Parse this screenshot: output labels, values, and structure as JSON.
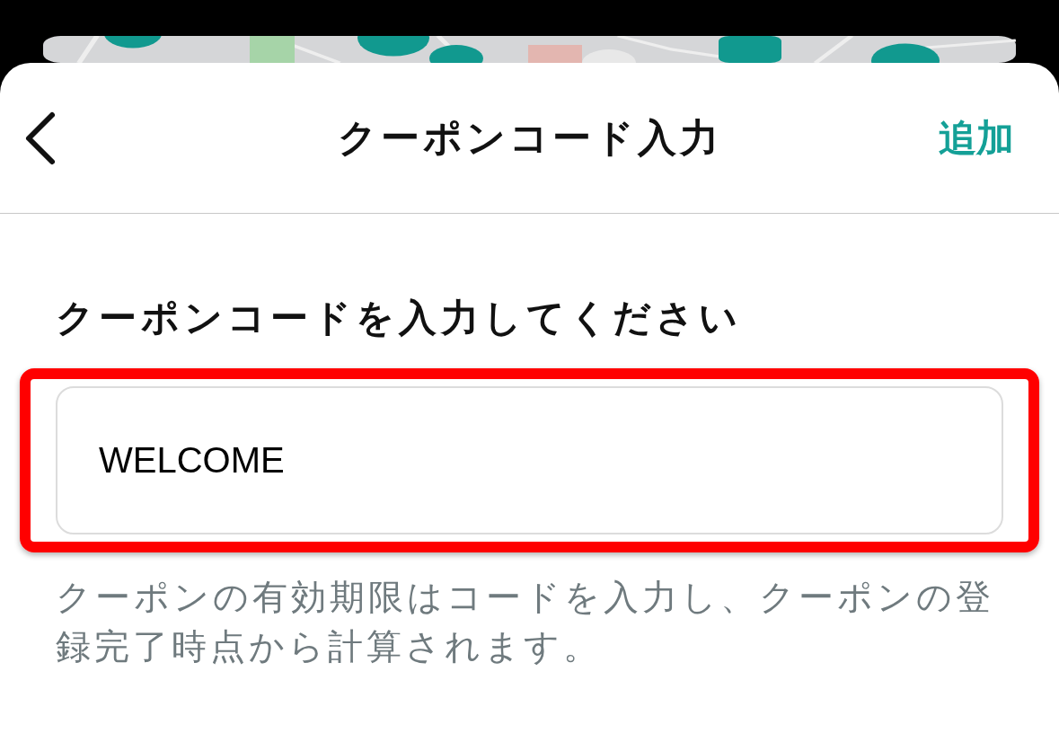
{
  "header": {
    "title": "クーポンコード入力",
    "action": "追加"
  },
  "form": {
    "label": "クーポンコードを入力してください",
    "value": "WELCOME",
    "highlighted": true,
    "note": "クーポンの有効期限はコードを入力し、クーポンの登録完了時点から計算されます。"
  }
}
